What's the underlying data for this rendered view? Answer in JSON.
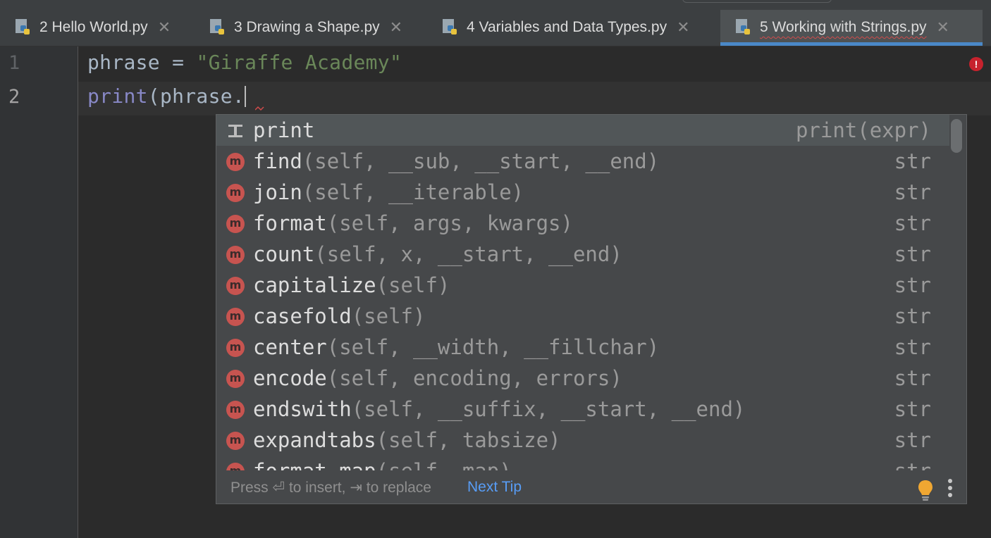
{
  "tabs": [
    {
      "label": "2 Hello World.py",
      "close": "✕",
      "active": false
    },
    {
      "label": "3 Drawing a Shape.py",
      "close": "✕",
      "active": false
    },
    {
      "label": "4 Variables and Data Types.py",
      "close": "✕",
      "active": false
    },
    {
      "label": "5 Working with Strings.py",
      "close": "✕",
      "active": true
    }
  ],
  "editor": {
    "line_numbers": [
      "1",
      "2"
    ],
    "line1": {
      "var": "phrase",
      "op": " = ",
      "string": "\"Giraffe Academy\""
    },
    "line2": {
      "builtin": "print",
      "rest": "(phrase."
    },
    "error_mark": "!"
  },
  "completion": {
    "items": [
      {
        "name": "print",
        "params": "",
        "type": "print(expr)",
        "kind": "template",
        "selected": true
      },
      {
        "name": "find",
        "params": "(self, __sub, __start, __end)",
        "type": "str",
        "kind": "m"
      },
      {
        "name": "join",
        "params": "(self, __iterable)",
        "type": "str",
        "kind": "m"
      },
      {
        "name": "format",
        "params": "(self, args, kwargs)",
        "type": "str",
        "kind": "m"
      },
      {
        "name": "count",
        "params": "(self, x, __start, __end)",
        "type": "str",
        "kind": "m"
      },
      {
        "name": "capitalize",
        "params": "(self)",
        "type": "str",
        "kind": "m"
      },
      {
        "name": "casefold",
        "params": "(self)",
        "type": "str",
        "kind": "m"
      },
      {
        "name": "center",
        "params": "(self, __width, __fillchar)",
        "type": "str",
        "kind": "m"
      },
      {
        "name": "encode",
        "params": "(self, encoding, errors)",
        "type": "str",
        "kind": "m"
      },
      {
        "name": "endswith",
        "params": "(self, __suffix, __start, __end)",
        "type": "str",
        "kind": "m"
      },
      {
        "name": "expandtabs",
        "params": "(self, tabsize)",
        "type": "str",
        "kind": "m"
      },
      {
        "name": "format_map",
        "params": "(self, map)",
        "type": "str",
        "kind": "m"
      }
    ],
    "footer_hint": "Press ⏎ to insert, ⇥ to replace",
    "next_tip": "Next Tip"
  },
  "colors": {
    "accent": "#4a88c7",
    "method_badge": "#c75450",
    "link": "#589df6",
    "string": "#6a8759"
  }
}
